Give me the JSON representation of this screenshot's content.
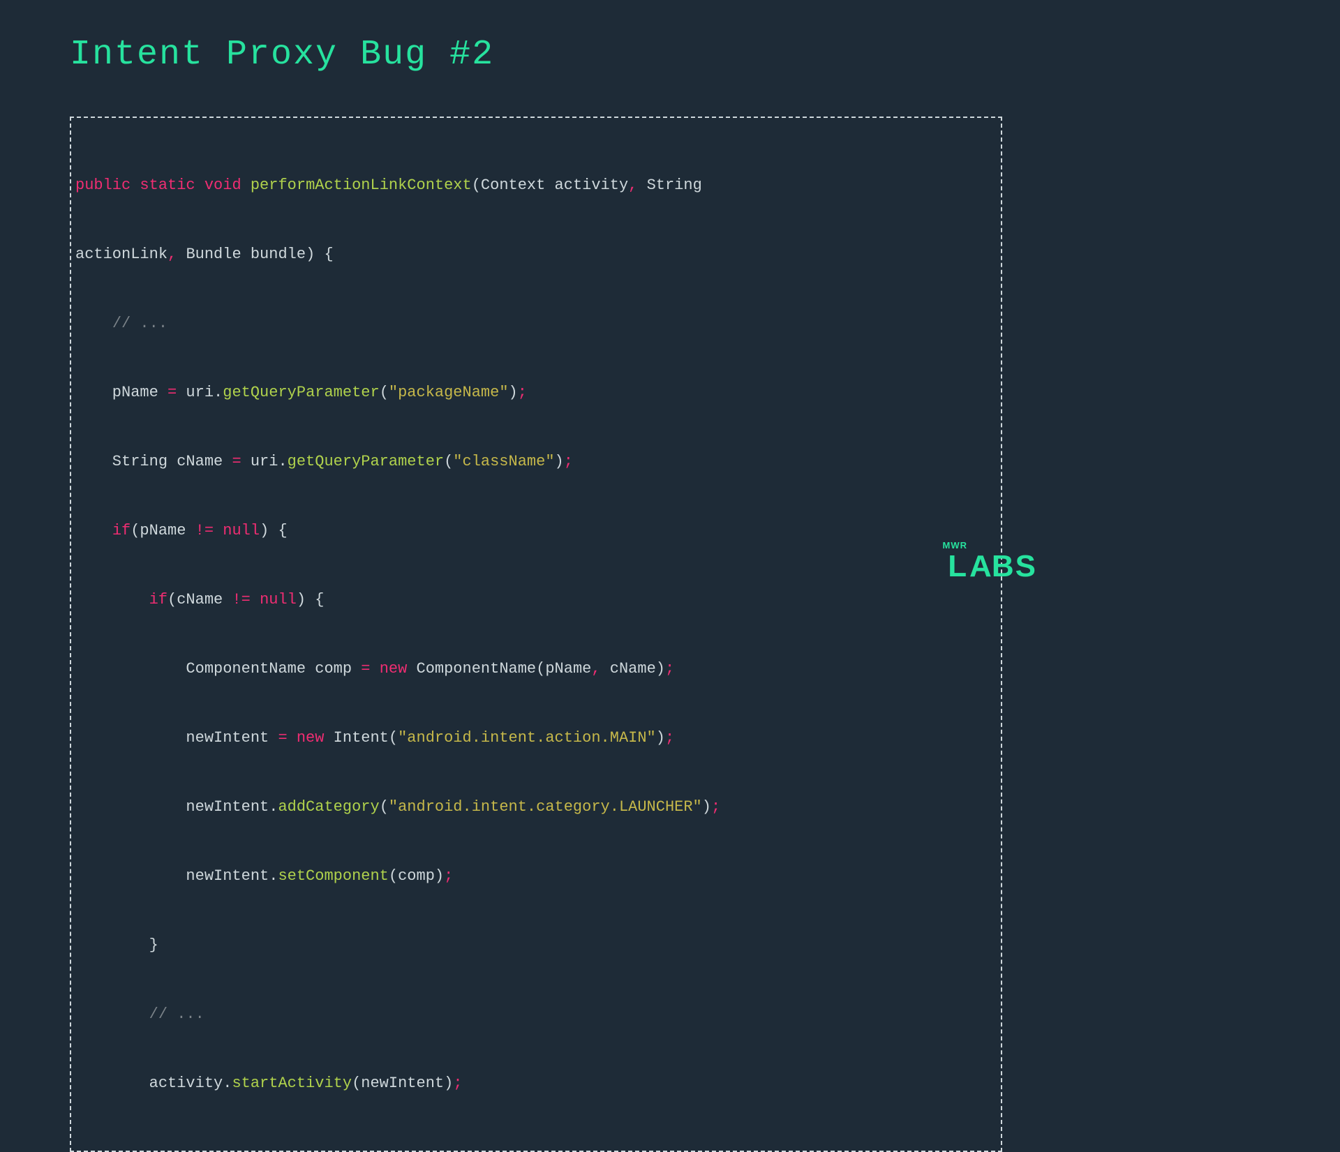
{
  "title": "Intent Proxy Bug #2",
  "code": {
    "l1": {
      "seg": [
        {
          "t": "public",
          "c": "kw"
        },
        {
          "t": " ",
          "c": "punc"
        },
        {
          "t": "static",
          "c": "kw"
        },
        {
          "t": " ",
          "c": "punc"
        },
        {
          "t": "void",
          "c": "kw"
        },
        {
          "t": " ",
          "c": "punc"
        },
        {
          "t": "performActionLinkContext",
          "c": "fn"
        },
        {
          "t": "(",
          "c": "punc"
        },
        {
          "t": "Context activity",
          "c": "type"
        },
        {
          "t": ",",
          "c": "kw"
        },
        {
          "t": " ",
          "c": "punc"
        },
        {
          "t": "String ",
          "c": "type"
        }
      ]
    },
    "l2": {
      "seg": [
        {
          "t": "actionLink",
          "c": "type"
        },
        {
          "t": ",",
          "c": "kw"
        },
        {
          "t": " ",
          "c": "punc"
        },
        {
          "t": "Bundle bundle",
          "c": "type"
        },
        {
          "t": ")",
          "c": "punc"
        },
        {
          "t": " ",
          "c": "punc"
        },
        {
          "t": "{",
          "c": "punc"
        }
      ]
    },
    "l3": {
      "seg": [
        {
          "t": "    ",
          "c": "punc"
        },
        {
          "t": "// ...",
          "c": "cm"
        }
      ]
    },
    "l4": {
      "seg": [
        {
          "t": "    pName ",
          "c": "type"
        },
        {
          "t": "=",
          "c": "kw"
        },
        {
          "t": " uri",
          "c": "type"
        },
        {
          "t": ".",
          "c": "punc"
        },
        {
          "t": "getQueryParameter",
          "c": "fn"
        },
        {
          "t": "(",
          "c": "punc"
        },
        {
          "t": "\"packageName\"",
          "c": "str"
        },
        {
          "t": ")",
          "c": "punc"
        },
        {
          "t": ";",
          "c": "kw"
        }
      ]
    },
    "l5": {
      "seg": [
        {
          "t": "    String cName ",
          "c": "type"
        },
        {
          "t": "=",
          "c": "kw"
        },
        {
          "t": " uri",
          "c": "type"
        },
        {
          "t": ".",
          "c": "punc"
        },
        {
          "t": "getQueryParameter",
          "c": "fn"
        },
        {
          "t": "(",
          "c": "punc"
        },
        {
          "t": "\"className\"",
          "c": "str"
        },
        {
          "t": ")",
          "c": "punc"
        },
        {
          "t": ";",
          "c": "kw"
        }
      ]
    },
    "l6": {
      "seg": [
        {
          "t": "    ",
          "c": "punc"
        },
        {
          "t": "if",
          "c": "kw"
        },
        {
          "t": "(pName ",
          "c": "type"
        },
        {
          "t": "!=",
          "c": "kw"
        },
        {
          "t": " ",
          "c": "punc"
        },
        {
          "t": "null",
          "c": "kw"
        },
        {
          "t": ")",
          "c": "punc"
        },
        {
          "t": " ",
          "c": "punc"
        },
        {
          "t": "{",
          "c": "punc"
        }
      ]
    },
    "l7": {
      "seg": [
        {
          "t": "        ",
          "c": "punc"
        },
        {
          "t": "if",
          "c": "kw"
        },
        {
          "t": "(cName ",
          "c": "type"
        },
        {
          "t": "!=",
          "c": "kw"
        },
        {
          "t": " ",
          "c": "punc"
        },
        {
          "t": "null",
          "c": "kw"
        },
        {
          "t": ")",
          "c": "punc"
        },
        {
          "t": " ",
          "c": "punc"
        },
        {
          "t": "{",
          "c": "punc"
        }
      ]
    },
    "l8": {
      "seg": [
        {
          "t": "            ComponentName comp ",
          "c": "type"
        },
        {
          "t": "=",
          "c": "kw"
        },
        {
          "t": " ",
          "c": "punc"
        },
        {
          "t": "new",
          "c": "kw"
        },
        {
          "t": " ComponentName",
          "c": "type"
        },
        {
          "t": "(",
          "c": "punc"
        },
        {
          "t": "pName",
          "c": "type"
        },
        {
          "t": ",",
          "c": "kw"
        },
        {
          "t": " cName",
          "c": "type"
        },
        {
          "t": ")",
          "c": "punc"
        },
        {
          "t": ";",
          "c": "kw"
        }
      ]
    },
    "l9": {
      "seg": [
        {
          "t": "            newIntent ",
          "c": "type"
        },
        {
          "t": "=",
          "c": "kw"
        },
        {
          "t": " ",
          "c": "punc"
        },
        {
          "t": "new",
          "c": "kw"
        },
        {
          "t": " Intent",
          "c": "type"
        },
        {
          "t": "(",
          "c": "punc"
        },
        {
          "t": "\"android.intent.action.MAIN\"",
          "c": "str"
        },
        {
          "t": ")",
          "c": "punc"
        },
        {
          "t": ";",
          "c": "kw"
        }
      ]
    },
    "l10": {
      "seg": [
        {
          "t": "            newIntent",
          "c": "type"
        },
        {
          "t": ".",
          "c": "punc"
        },
        {
          "t": "addCategory",
          "c": "fn"
        },
        {
          "t": "(",
          "c": "punc"
        },
        {
          "t": "\"android.intent.category.LAUNCHER\"",
          "c": "str"
        },
        {
          "t": ")",
          "c": "punc"
        },
        {
          "t": ";",
          "c": "kw"
        }
      ]
    },
    "l11": {
      "seg": [
        {
          "t": "            newIntent",
          "c": "type"
        },
        {
          "t": ".",
          "c": "punc"
        },
        {
          "t": "setComponent",
          "c": "fn"
        },
        {
          "t": "(",
          "c": "punc"
        },
        {
          "t": "comp",
          "c": "type"
        },
        {
          "t": ")",
          "c": "punc"
        },
        {
          "t": ";",
          "c": "kw"
        }
      ]
    },
    "l12": {
      "seg": [
        {
          "t": "        }",
          "c": "punc"
        }
      ]
    },
    "l13": {
      "seg": [
        {
          "t": "        ",
          "c": "punc"
        },
        {
          "t": "// ...",
          "c": "cm"
        }
      ]
    },
    "l14": {
      "seg": [
        {
          "t": "        activity",
          "c": "type"
        },
        {
          "t": ".",
          "c": "punc"
        },
        {
          "t": "startActivity",
          "c": "fn"
        },
        {
          "t": "(",
          "c": "punc"
        },
        {
          "t": "newIntent",
          "c": "type"
        },
        {
          "t": ")",
          "c": "punc"
        },
        {
          "t": ";",
          "c": "kw"
        }
      ]
    }
  },
  "logo": {
    "top": "MWR",
    "bottom": "LABS"
  }
}
